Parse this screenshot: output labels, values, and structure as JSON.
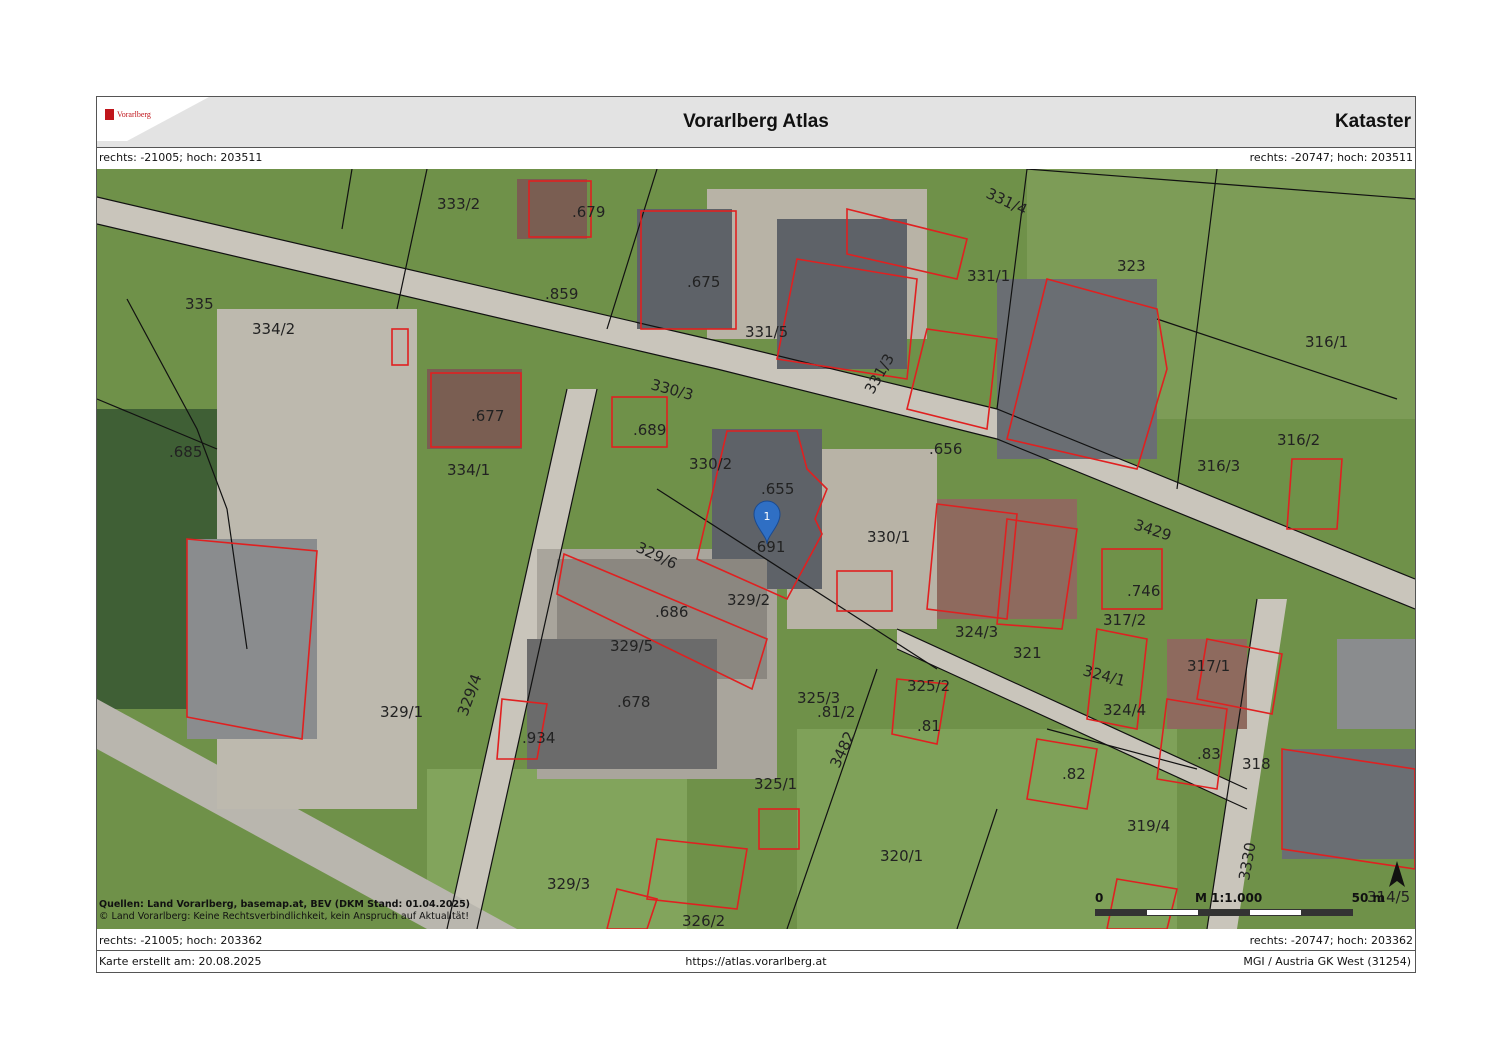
{
  "header": {
    "logo_text": "Vorarlberg",
    "title": "Vorarlberg Atlas",
    "right_label": "Kataster"
  },
  "coords": {
    "top_left": "rechts: -21005; hoch: 203511",
    "top_right": "rechts: -20747; hoch: 203511",
    "bottom_left": "rechts: -21005; hoch: 203362",
    "bottom_right": "rechts: -20747; hoch: 203362"
  },
  "map": {
    "marker_label": "1",
    "parcel_labels": [
      {
        "text": "333/2"
      },
      {
        "text": ".679"
      },
      {
        "text": "331/4"
      },
      {
        "text": ".675"
      },
      {
        "text": ".859"
      },
      {
        "text": "335"
      },
      {
        "text": "334/2"
      },
      {
        "text": "331/5"
      },
      {
        "text": "331/1"
      },
      {
        "text": "323"
      },
      {
        "text": "316/1"
      },
      {
        "text": "330/3"
      },
      {
        "text": "331/3"
      },
      {
        "text": ".677"
      },
      {
        "text": ".689"
      },
      {
        "text": ".685"
      },
      {
        "text": "330/2"
      },
      {
        "text": "334/1"
      },
      {
        "text": ".656"
      },
      {
        "text": "316/2"
      },
      {
        "text": "316/3"
      },
      {
        "text": ".655"
      },
      {
        "text": "3429"
      },
      {
        "text": "330/1"
      },
      {
        "text": ".691"
      },
      {
        "text": "329/6"
      },
      {
        "text": ".746"
      },
      {
        "text": ".686"
      },
      {
        "text": "329/2"
      },
      {
        "text": "324/3"
      },
      {
        "text": "317/2"
      },
      {
        "text": "329/5"
      },
      {
        "text": "321"
      },
      {
        "text": "324/1"
      },
      {
        "text": "317/1"
      },
      {
        "text": "325/3"
      },
      {
        "text": "325/2"
      },
      {
        "text": ".678"
      },
      {
        "text": ".81/2"
      },
      {
        "text": "324/4"
      },
      {
        "text": "329/1"
      },
      {
        "text": ".934"
      },
      {
        "text": "329/4"
      },
      {
        "text": ".81"
      },
      {
        "text": ".83"
      },
      {
        "text": "318"
      },
      {
        "text": "3482"
      },
      {
        "text": ".82"
      },
      {
        "text": "325/1"
      },
      {
        "text": "319/4"
      },
      {
        "text": "320/1"
      },
      {
        "text": "329/3"
      },
      {
        "text": "3330"
      },
      {
        "text": "326/2"
      },
      {
        "text": "314/5"
      }
    ],
    "colors": {
      "parcel_outline": "#e02020",
      "boundary": "#111111",
      "grass": "#6f9149",
      "road": "#c9c5bb",
      "roof_grey": "#6a6e73",
      "marker": "#2f6fc4"
    }
  },
  "sources": {
    "line1": "Quellen: Land Vorarlberg, basemap.at, BEV (DKM Stand: 01.04.2025)",
    "line2": "© Land Vorarlberg: Keine Rechtsverbindlichkeit, kein Anspruch auf Aktualität!"
  },
  "scalebar": {
    "zero": "0",
    "scale": "M 1:1.000",
    "end": "50 m"
  },
  "footer": {
    "created": "Karte erstellt am: 20.08.2025",
    "url": "https://atlas.vorarlberg.at",
    "crs": "MGI / Austria GK West (31254)"
  }
}
